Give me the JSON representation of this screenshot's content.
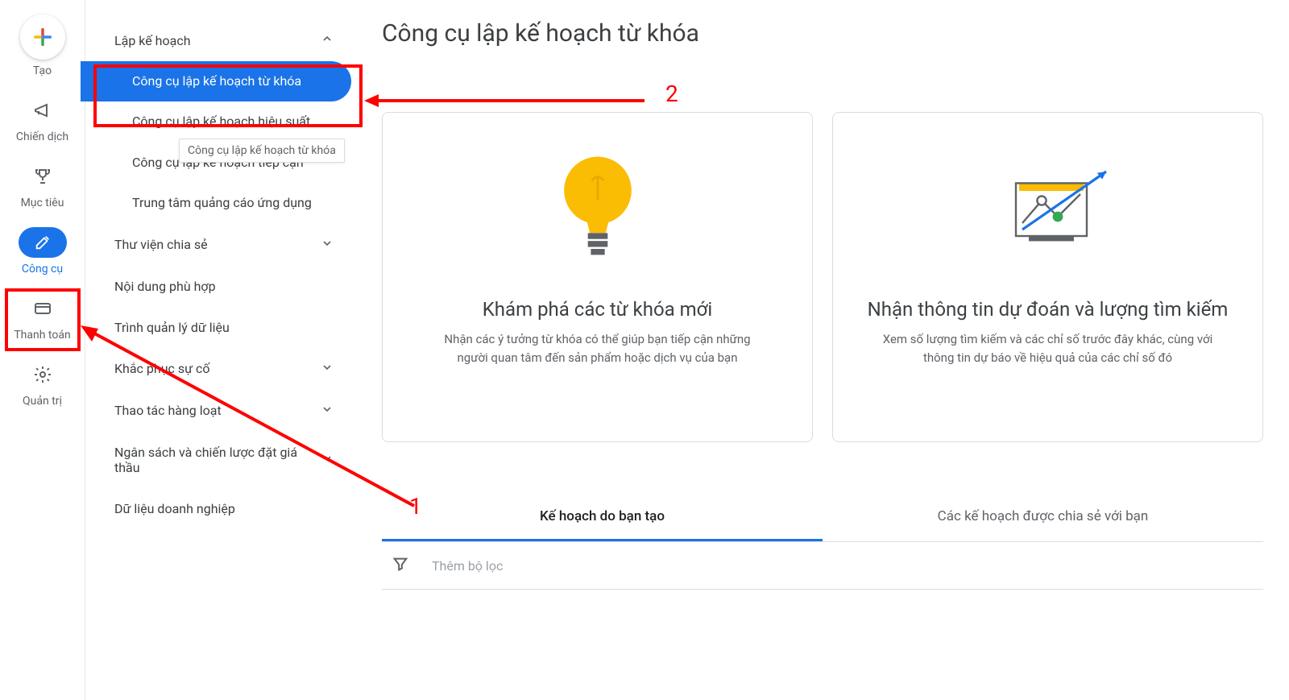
{
  "rail": {
    "create_label": "Tạo",
    "items": [
      {
        "key": "campaigns",
        "label": "Chiến dịch"
      },
      {
        "key": "goals",
        "label": "Mục tiêu"
      },
      {
        "key": "tools",
        "label": "Công cụ"
      },
      {
        "key": "billing",
        "label": "Thanh toán"
      },
      {
        "key": "admin",
        "label": "Quản trị"
      }
    ]
  },
  "sidebar": {
    "groups": [
      {
        "label": "Lập kế hoạch",
        "expanded": true,
        "items": [
          "Công cụ lập kế hoạch từ khóa",
          "Công cụ lập kế hoạch hiệu suất",
          "Công cụ lập kế hoạch tiếp cận",
          "Trung tâm quảng cáo ứng dụng"
        ]
      },
      {
        "label": "Thư viện chia sẻ",
        "expanded": false
      },
      {
        "label": "Nội dung phù hợp",
        "expanded": null
      },
      {
        "label": "Trình quản lý dữ liệu",
        "expanded": null
      },
      {
        "label": "Khắc phục sự cố",
        "expanded": false
      },
      {
        "label": "Thao tác hàng loạt",
        "expanded": false
      },
      {
        "label": "Ngân sách và chiến lược đặt giá thầu",
        "expanded": false
      },
      {
        "label": "Dữ liệu doanh nghiệp",
        "expanded": null
      }
    ],
    "tooltip": "Công cụ lập kế hoạch từ khóa"
  },
  "main": {
    "title": "Công cụ lập kế hoạch từ khóa",
    "cards": [
      {
        "title": "Khám phá các từ khóa mới",
        "desc": "Nhận các ý tưởng từ khóa có thể giúp bạn tiếp cận những người quan tâm đến sản phẩm hoặc dịch vụ của bạn"
      },
      {
        "title": "Nhận thông tin dự đoán và lượng tìm kiếm",
        "desc": "Xem số lượng tìm kiếm và các chỉ số trước đây khác, cùng với thông tin dự báo về hiệu quả của các chỉ số đó"
      }
    ],
    "tabs": [
      "Kế hoạch do bạn tạo",
      "Các kế hoạch được chia sẻ với bạn"
    ],
    "filter_placeholder": "Thêm bộ lọc"
  },
  "annotations": {
    "label1": "1",
    "label2": "2"
  }
}
